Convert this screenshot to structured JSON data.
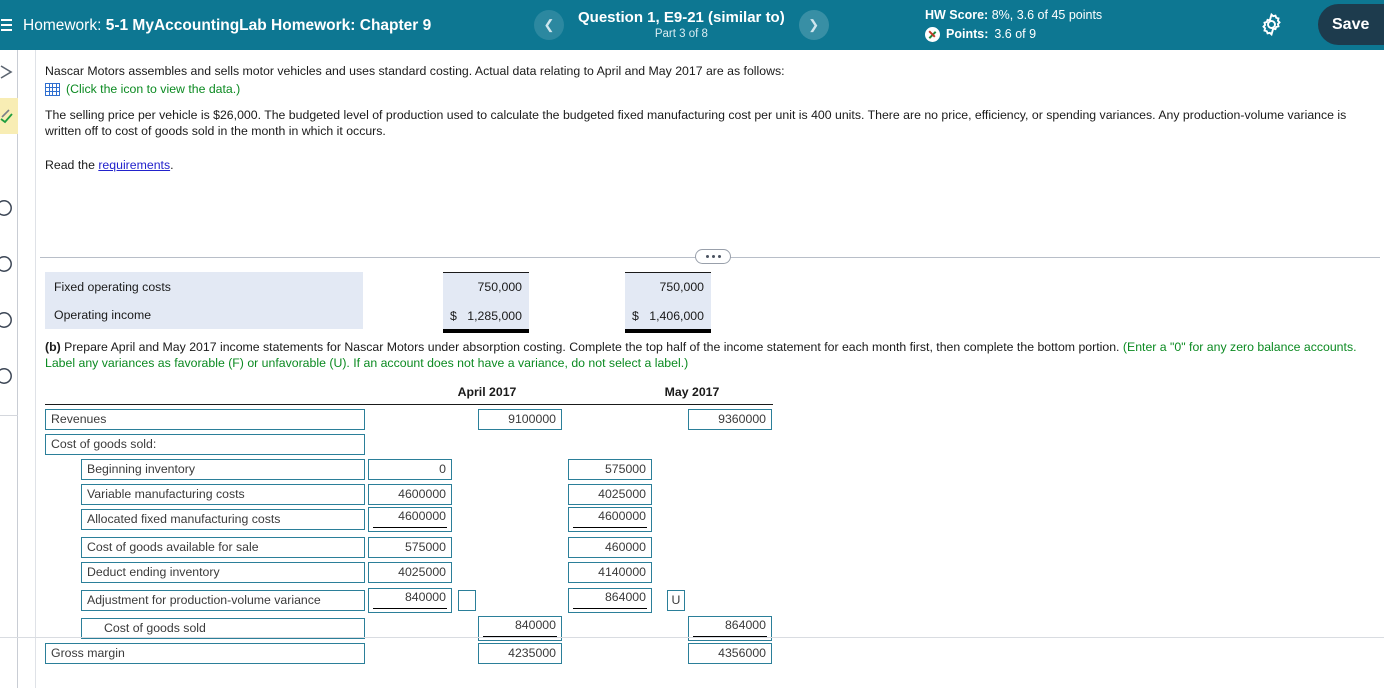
{
  "header": {
    "menu_icon": "hamburger-icon",
    "homework_label": "Homework:",
    "homework_name": "5-1 MyAccountingLab Homework: Chapter 9",
    "prev_icon": "chevron-left-icon",
    "next_icon": "chevron-right-icon",
    "question_title": "Question 1, E9-21 (similar to)",
    "question_part": "Part 3 of 8",
    "hw_score_label": "HW Score:",
    "hw_score_value": "8%, 3.6 of 45 points",
    "points_label": "Points:",
    "points_value": "3.6 of 9",
    "points_icon": "pencil-score-icon",
    "settings_icon": "gear-icon",
    "save_label": "Save",
    "bg_color": "#0d7792",
    "save_bg_color": "#1d3b4d"
  },
  "rail": {
    "items": [
      {
        "name": "arrow-right-icon",
        "active": false
      },
      {
        "name": "pencil-check-icon",
        "active": true
      },
      {
        "name": "circle-icon",
        "active": false
      },
      {
        "name": "circle-icon",
        "active": false
      },
      {
        "name": "circle-icon",
        "active": false
      },
      {
        "name": "circle-icon",
        "active": false
      }
    ]
  },
  "problem": {
    "paragraph1": "Nascar Motors assembles and sells motor vehicles and uses standard costing. Actual data relating to April and May 2017 are as follows:",
    "data_icon": "spreadsheet-icon",
    "data_link": "(Click the icon to view the data.)",
    "paragraph2": "The selling price per vehicle is $26,000. The budgeted level of production used to calculate the budgeted fixed manufacturing cost per unit is 400 units. There are no price, efficiency, or spending variances. Any production-volume variance is written off to cost of goods sold in the month in which it occurs.",
    "read_prefix": "Read the ",
    "read_link": "requirements",
    "read_suffix": ".",
    "collapse_handle_icon": "ellipsis-handle-icon"
  },
  "upper_statement": {
    "rows": [
      {
        "label": "Fixed operating costs",
        "april": "750,000",
        "may": "750,000",
        "topline": true,
        "dollar": false,
        "double_rule": false
      },
      {
        "label": "Operating income",
        "april": "1,285,000",
        "may": "1,406,000",
        "topline": false,
        "dollar": true,
        "dollar_sign": "$",
        "double_rule": true
      }
    ]
  },
  "instruction_b": {
    "prefix_bold": "(b)",
    "black_text_1": " Prepare April and May 2017 income statements for Nascar Motors under absorption costing. Complete the top half of the income statement for each month first, then complete the bottom portion. ",
    "green_text": "(Enter a \"0\" for any zero balance accounts. Label any variances as favorable (F) or unfavorable (U). If an account does not have a variance, do not select a label.)"
  },
  "statement": {
    "columns": [
      "April 2017",
      "May 2017"
    ],
    "rows": [
      {
        "label": "Revenues",
        "indent": 0,
        "april_outer": "9100000",
        "may_outer": "9360000",
        "april_inner": null,
        "may_inner": null,
        "underline": false,
        "selector": false
      },
      {
        "label": "Cost of goods sold:",
        "indent": 0,
        "april_outer": null,
        "may_outer": null,
        "april_inner": null,
        "may_inner": null,
        "underline": false,
        "selector": false
      },
      {
        "label": "Beginning inventory",
        "indent": 1,
        "april_outer": null,
        "may_outer": null,
        "april_inner": "0",
        "may_inner": "575000",
        "underline": false,
        "selector": false
      },
      {
        "label": "Variable manufacturing costs",
        "indent": 1,
        "april_outer": null,
        "may_outer": null,
        "april_inner": "4600000",
        "may_inner": "4025000",
        "underline": false,
        "selector": false
      },
      {
        "label": "Allocated fixed manufacturing costs",
        "indent": 1,
        "april_outer": null,
        "may_outer": null,
        "april_inner": "4600000",
        "may_inner": "4600000",
        "underline": true,
        "selector": false
      },
      {
        "label": "Cost of goods available for sale",
        "indent": 1,
        "april_outer": null,
        "may_outer": null,
        "april_inner": "575000",
        "may_inner": "460000",
        "underline": false,
        "selector": false
      },
      {
        "label": "Deduct ending inventory",
        "indent": 1,
        "april_outer": null,
        "may_outer": null,
        "april_inner": "4025000",
        "may_inner": "4140000",
        "underline": false,
        "selector": false
      },
      {
        "label": "Adjustment for production-volume variance",
        "indent": 1,
        "april_outer": null,
        "may_outer": null,
        "april_inner": "840000",
        "may_inner": "864000",
        "underline": true,
        "selector": true,
        "april_selector": "",
        "may_selector": "U"
      },
      {
        "label": "Cost of goods sold",
        "indent": 2,
        "april_outer": "840000",
        "may_outer": "864000",
        "april_inner": null,
        "may_inner": null,
        "underline": true,
        "selector": false
      },
      {
        "label": "Gross margin",
        "indent": 0,
        "april_outer": "4235000",
        "may_outer": "4356000",
        "april_inner": null,
        "may_inner": null,
        "underline": false,
        "selector": false
      }
    ]
  }
}
